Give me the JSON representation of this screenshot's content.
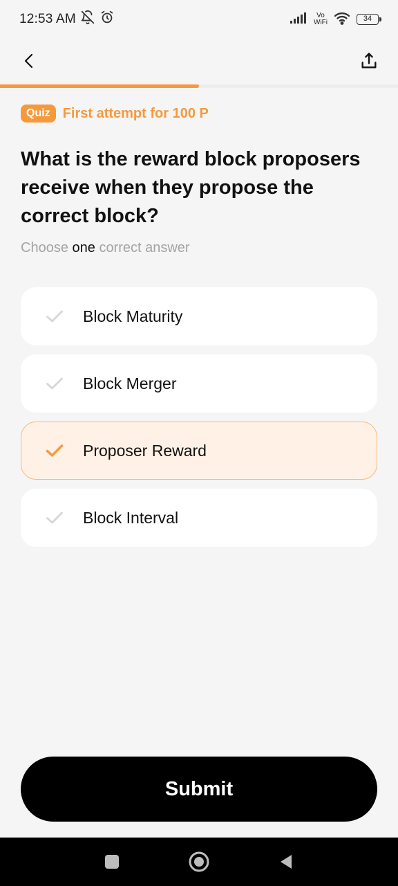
{
  "status_bar": {
    "time": "12:53 AM",
    "vowifi_top": "Vo",
    "vowifi_bottom": "WiFi",
    "battery": "34"
  },
  "header": {
    "back_icon": "chevron-left-icon",
    "share_icon": "share-upload-icon"
  },
  "progress": {
    "fraction": 0.5,
    "color": "#f59a3c"
  },
  "quiz": {
    "badge": "Quiz",
    "attempt_text": "First attempt for 100 P"
  },
  "question": "What is the reward block proposers receive when they propose the correct block?",
  "hint": {
    "prefix": "Choose",
    "emphasis": "one",
    "suffix": "correct answer"
  },
  "options": [
    {
      "label": "Block Maturity",
      "selected": false
    },
    {
      "label": "Block Merger",
      "selected": false
    },
    {
      "label": "Proposer Reward",
      "selected": true
    },
    {
      "label": "Block Interval",
      "selected": false
    }
  ],
  "submit_label": "Submit",
  "colors": {
    "accent": "#f59a3c",
    "selected_bg": "#fff1e6",
    "unselected_check": "#d6d6d6"
  }
}
